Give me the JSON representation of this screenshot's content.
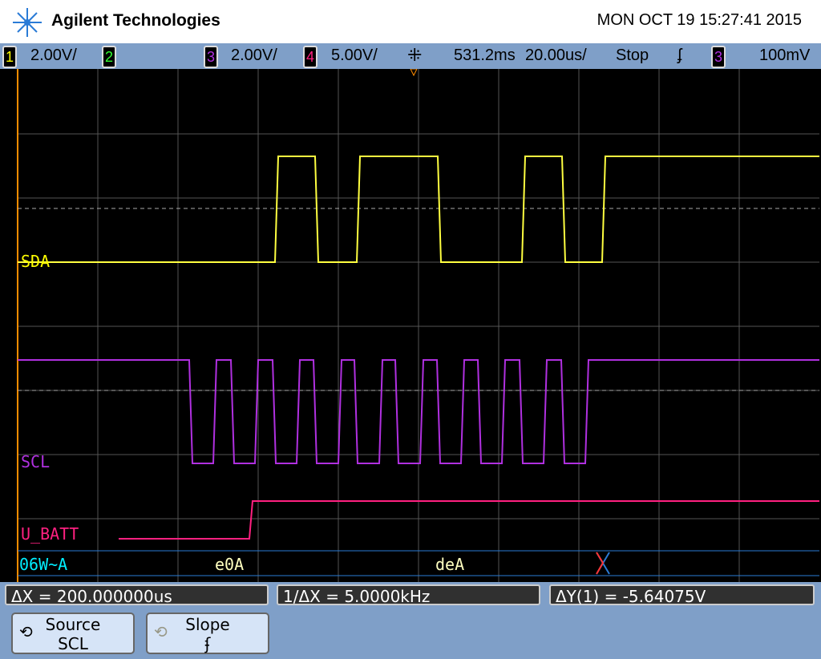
{
  "header": {
    "brand": "Agilent Technologies",
    "datetime": "MON OCT 19 15:27:41 2015"
  },
  "status": {
    "ch1_num": "1",
    "ch1_scale": "2.00V/",
    "ch2_num": "2",
    "ch3_num": "3",
    "ch3_scale": "2.00V/",
    "ch4_num": "4",
    "ch4_scale": "5.00V/",
    "delay": "531.2ms",
    "timebase": "20.00us/",
    "run_state": "Stop",
    "trigger_slope": "rising",
    "trigger_src": "3",
    "trigger_level": "100mV"
  },
  "labels": {
    "sda": "SDA",
    "scl": "SCL",
    "ubatt": "U_BATT",
    "decode": [
      "06W~A",
      "e0A",
      "deA"
    ]
  },
  "measurements": {
    "dx": "ΔX = 200.000000us",
    "inv_dx": "1/ΔX = 5.0000kHz",
    "dy": "ΔY(1) = -5.64075V"
  },
  "softkeys": {
    "source_label": "Source",
    "source_value": "SCL",
    "slope_label": "Slope",
    "slope_value": "ʄ"
  },
  "colors": {
    "ch1": "#ffff40",
    "ch3": "#b030e0",
    "ch4": "#ff2080",
    "decode": "#00e0ff",
    "bus": "#ffffc0"
  },
  "chart_data": {
    "type": "line",
    "time_unit": "us",
    "time_range": [
      0,
      200
    ],
    "series": [
      {
        "name": "SDA",
        "low": 0,
        "high": 1,
        "initial": 0,
        "edges": [
          64.6,
          74.6,
          85,
          105.2,
          126.2,
          136.2,
          146.2
        ]
      },
      {
        "name": "SCL",
        "low": 0,
        "high": 1,
        "initial": 1,
        "edges": [
          43.2,
          49.2,
          53.6,
          59.6,
          64,
          70,
          74.2,
          80.4,
          84.4,
          90.6,
          94.6,
          100.8,
          105,
          111,
          115.2,
          121.2,
          125.6,
          131.6,
          136,
          142
        ]
      },
      {
        "name": "U_BATT",
        "low": 0,
        "high": 1,
        "initial": 0,
        "start": 25.2,
        "edges": [
          58.2
        ]
      }
    ]
  }
}
